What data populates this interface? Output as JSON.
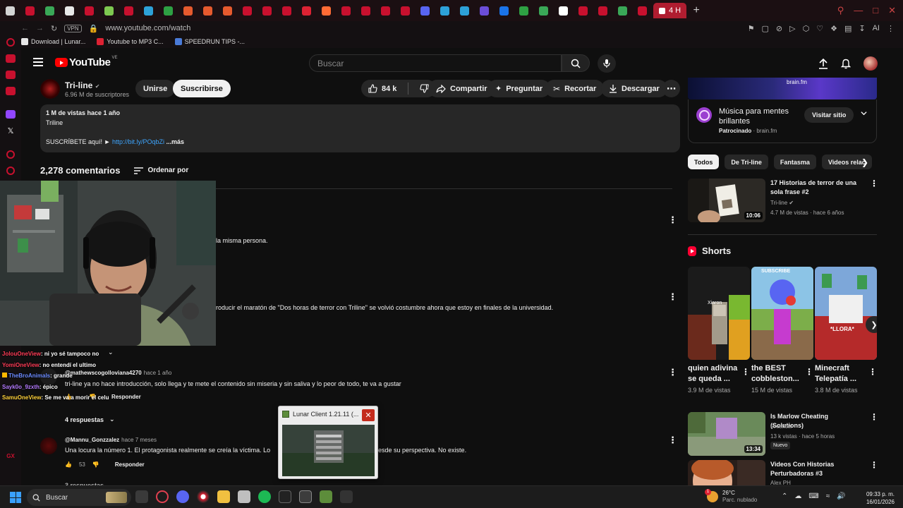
{
  "browser": {
    "active_tab_label": "4 H",
    "url": "www.youtube.com/watch",
    "vpn_label": "VPN",
    "ai_label": "AI",
    "bookmarks": [
      {
        "label": "Download | Lunar...",
        "color": "#e8e8e8"
      },
      {
        "label": "Youtube to MP3 C...",
        "color": "#d23"
      },
      {
        "label": "SPEEDRUN TIPS -...",
        "color": "#4a7bd8"
      }
    ],
    "tab_favicon_colors": [
      "#d4d4d4",
      "#c8102e",
      "#3aa757",
      "#e8e8e8",
      "#c8102e",
      "#7ec850",
      "#c8102e",
      "#2da1d8",
      "#2ea043",
      "#e65a2e",
      "#e65a2e",
      "#e65a2e",
      "#c8102e",
      "#c8102e",
      "#c8102e",
      "#d23",
      "#ff6b35",
      "#c8102e",
      "#c8102e",
      "#c8102e",
      "#c8102e",
      "#5865f2",
      "#2da1d8",
      "#2da1d8",
      "#6b4dd8",
      "#1a73e8",
      "#2ea043",
      "#3aa757",
      "#ffffff",
      "#c8102e",
      "#c8102e",
      "#3aa757",
      "#c8102e"
    ]
  },
  "youtube": {
    "logo_text": "YouTube",
    "country_code": "VE",
    "search_placeholder": "Buscar"
  },
  "channel": {
    "name": "Tri-line",
    "subscribers": "6.96 M de suscriptores",
    "join_label": "Unirse",
    "subscribe_label": "Suscribirse",
    "likes": "84 k",
    "share_label": "Compartir",
    "ask_label": "Preguntar",
    "clip_label": "Recortar",
    "download_label": "Descargar"
  },
  "description": {
    "meta": "1 M de vistas  hace 1 año",
    "line2": "Triline",
    "line3_prefix": "SUSCRÍBETE aquí! ►",
    "link": "http://bit.ly/POqbZi",
    "more": "...más"
  },
  "comments_header": {
    "count": "2,278 comentarios",
    "sort_label": "Ordenar por"
  },
  "comments": {
    "frag1": "la misma persona.",
    "frag2": "roducir el maratón de \"Dos horas de terror con Triline\" se volvió costumbre ahora que estoy en finales de la universidad.",
    "c3_author": "@mathewscogolloviana4270",
    "c3_time": "hace 1 año",
    "c3_text": "tri-line ya no hace introducción, solo llega y te mete el contenido sin miseria y sin saliva y lo peor de todo, te va a gustar",
    "c3_reply": "Responder",
    "c3_replies": "4 respuestas",
    "c4_author": "@Mannu_Gonzzalez",
    "c4_time": "hace 7 meses",
    "c4_text": "Una locura la número 1. El protagonista realmente se creía la víctima. Lo",
    "c4_text_tail": "esde su perspectiva. No existe.",
    "c4_likes": "53",
    "c4_reply": "Responder",
    "c5_replies": "3 respuestas"
  },
  "chat": [
    {
      "user": "JolouOneView",
      "msg": ": ni yo sé tampoco no",
      "color": "red"
    },
    {
      "user": "YomiOneView",
      "msg": ": no entendí el ultimo",
      "color": "red"
    },
    {
      "user": "TheBroAnimals",
      "msg": ": grande",
      "color": "blue"
    },
    {
      "user": "Sayk0o_9zxth",
      "msg": ": épico",
      "color": "purple"
    },
    {
      "user": "SamuOneView",
      "msg": ": Se me va a morir el celu",
      "color": "gold"
    }
  ],
  "ad": {
    "banner_label": "brain.fm",
    "title": "Música para mentes brillantes",
    "sponsored": "Patrocinado",
    "domain": "brain.fm",
    "visit_label": "Visitar sitio"
  },
  "chips": [
    "Todos",
    "De Tri-line",
    "Fantasma",
    "Videos relac"
  ],
  "videos": [
    {
      "title": "17 Historias de terror de una sola frase #2",
      "channel": "Tri-line",
      "meta": "4.7 M de vistas · hace 6 años",
      "duration": "10:06"
    },
    {
      "title": "Is Marlow Cheating (Solutions)",
      "channel": "tivesflow",
      "meta": "13 k vistas · hace 5 horas",
      "badge": "Nuevo",
      "duration": "13:34"
    },
    {
      "title": "Videos Con Historias Perturbadoras #3",
      "channel": "Alex PH"
    }
  ],
  "shorts": {
    "heading": "Shorts",
    "items": [
      {
        "title": "quien adivina se queda ...",
        "views": "3.9 M de vistas",
        "overlay": "Xiaron"
      },
      {
        "title": "the BEST cobbleston...",
        "views": "15 M de vistas",
        "overlay": "SUBSCRIBE"
      },
      {
        "title": "Minecraft Telepatía ...",
        "views": "3.8 M de vistas",
        "overlay": "*LLORA*"
      }
    ]
  },
  "popup": {
    "title": "Lunar Client 1.21.11 (..."
  },
  "taskbar": {
    "search_placeholder": "Buscar",
    "temperature": "26°C",
    "weather": "Parc. nublado",
    "time": "09:33 p. m.",
    "date": "16/01/2026",
    "weather_badge": "1"
  }
}
